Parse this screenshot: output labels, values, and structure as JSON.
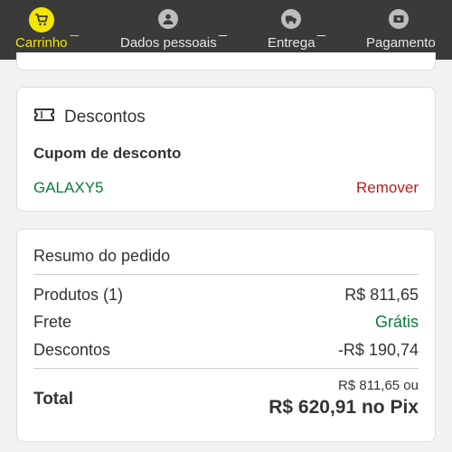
{
  "steps": [
    {
      "label": "Carrinho",
      "icon": "cart-icon",
      "active": true
    },
    {
      "label": "Dados pessoais",
      "icon": "user-icon",
      "active": false
    },
    {
      "label": "Entrega",
      "icon": "truck-icon",
      "active": false
    },
    {
      "label": "Pagamento",
      "icon": "wallet-icon",
      "active": false
    }
  ],
  "step_separator": "_",
  "discounts": {
    "title": "Descontos",
    "icon": "ticket-icon",
    "coupon_title": "Cupom de desconto",
    "coupon_code": "GALAXY5",
    "remove_label": "Remover"
  },
  "summary": {
    "title": "Resumo do pedido",
    "rows": [
      {
        "label": "Produtos (1)",
        "value": "R$ 811,65"
      },
      {
        "label": "Frete",
        "value": "Grátis"
      },
      {
        "label": "Descontos",
        "value": "-R$ 190,74"
      }
    ],
    "total_label": "Total",
    "total_regular": "R$ 811,65 ou",
    "total_pix": "R$ 620,91 no Pix"
  },
  "colors": {
    "topbar": "#3a3a3a",
    "accent": "#f2e600",
    "green": "#0a7a3c",
    "red": "#c01a1a"
  }
}
